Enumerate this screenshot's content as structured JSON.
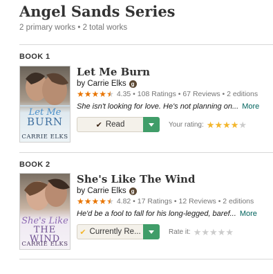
{
  "series": {
    "title": "Angel Sands Series",
    "subtitle": "2 primary works • 2 total works"
  },
  "books": [
    {
      "number": "BOOK 1",
      "title": "Let Me Burn",
      "author": "by Carrie Elks",
      "average_rating": "4.35",
      "star_rating": 4.35,
      "ratings": "108 Ratings",
      "reviews": "67 Reviews",
      "editions": "2 editions",
      "description": "She isn't looking for love. He's not planning on...",
      "more_label": "More",
      "shelf_label": "Read",
      "shelf_icon": "check-icon",
      "user_rating_label": "Your rating:",
      "user_rating": 4,
      "cover": {
        "script_title": "Let Me",
        "caps_title": "BURN",
        "author": "CARRIE ELKS",
        "accent": "#4a8fc9"
      }
    },
    {
      "number": "BOOK 2",
      "title": "She's Like The Wind",
      "author": "by Carrie Elks",
      "average_rating": "4.82",
      "star_rating": 4.82,
      "ratings": "17 Ratings",
      "reviews": "12 Reviews",
      "editions": "2 editions",
      "description": "He'd be a fool to fall for his long-legged, baref...",
      "more_label": "More",
      "shelf_label": "Currently Re...",
      "shelf_icon": "check-icon",
      "user_rating_label": "Rate it:",
      "user_rating": 0,
      "cover": {
        "script_title": "She's Like",
        "caps_title": "THE WIND",
        "author": "CARRIE ELKS",
        "accent": "#8e6bb3"
      }
    }
  ],
  "colors": {
    "star_orange": "#e87400",
    "star_yellow": "#f3b62c",
    "green_button": "#409d69",
    "link_teal": "#00635d",
    "button_beige": "#f4f1ea"
  }
}
